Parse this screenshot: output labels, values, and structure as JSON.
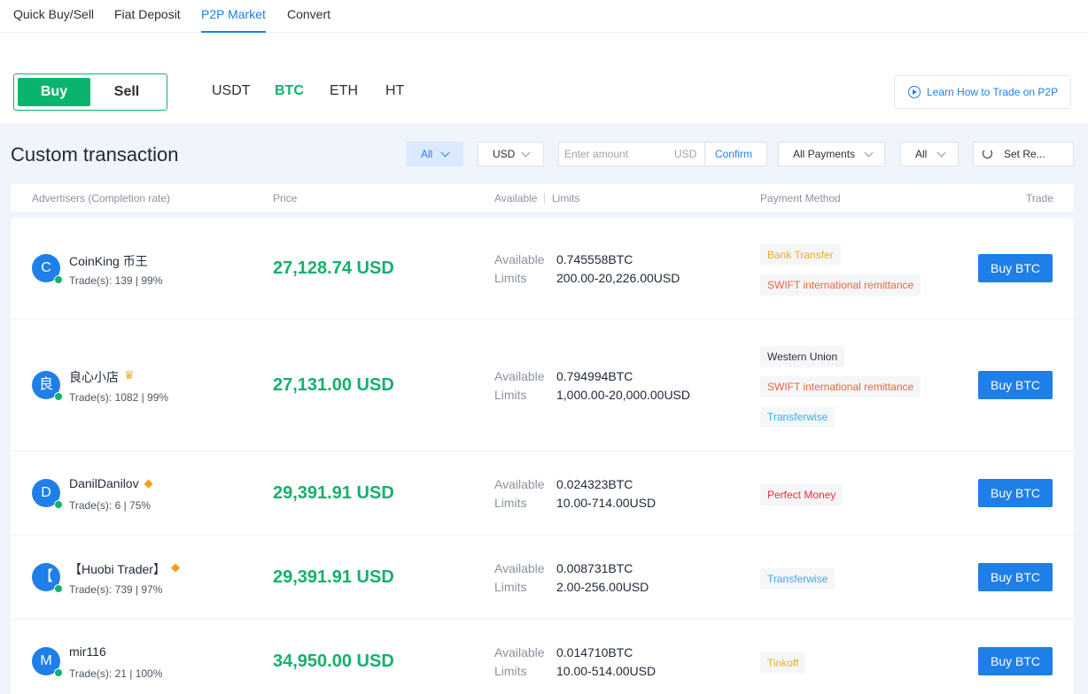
{
  "nav": {
    "tabs": [
      {
        "label": "Quick Buy/Sell"
      },
      {
        "label": "Fiat Deposit"
      },
      {
        "label": "P2P Market"
      },
      {
        "label": "Convert"
      }
    ]
  },
  "trade_side": {
    "buy": "Buy",
    "sell": "Sell"
  },
  "coins": [
    "USDT",
    "BTC",
    "ETH",
    "HT"
  ],
  "learn_link": "Learn How to Trade on P2P",
  "title": "Custom transaction",
  "filters": {
    "all": "All",
    "currency": "USD",
    "amount_placeholder": "Enter amount",
    "amount_unit": "USD",
    "confirm": "Confirm",
    "payments": "All Payments",
    "all2": "All",
    "set_refresh": "Set Re..."
  },
  "table_header": {
    "advertisers": "Advertisers (Completion rate)",
    "price": "Price",
    "available": "Available",
    "limits": "Limits",
    "payment": "Payment Method",
    "trade": "Trade"
  },
  "labels": {
    "available": "Available",
    "limits": "Limits",
    "buy_button": "Buy BTC"
  },
  "rows": [
    {
      "initial": "C",
      "name": "CoinKing 币王",
      "trades": "Trade(s): 139 | 99%",
      "price": "27,128.74 USD",
      "available": "0.745558BTC",
      "limits": "200.00-20,226.00USD",
      "payments": [
        "Bank Transfer",
        "SWIFT international remittance"
      ]
    },
    {
      "initial": "良",
      "name": "良心小店",
      "trades": "Trade(s): 1082 | 99%",
      "price": "27,131.00 USD",
      "available": "0.794994BTC",
      "limits": "1,000.00-20,000.00USD",
      "payments": [
        "Western Union",
        "SWIFT international remittance",
        "Transferwise"
      ]
    },
    {
      "initial": "D",
      "name": "DanilDanilov",
      "trades": "Trade(s): 6 | 75%",
      "price": "29,391.91 USD",
      "available": "0.024323BTC",
      "limits": "10.00-714.00USD",
      "payments": [
        "Perfect Money"
      ]
    },
    {
      "initial": "【",
      "name": "【Huobi Trader】",
      "trades": "Trade(s): 739 | 97%",
      "price": "29,391.91 USD",
      "available": "0.008731BTC",
      "limits": "2.00-256.00USD",
      "payments": [
        "Transferwise"
      ]
    },
    {
      "initial": "M",
      "name": "mir116",
      "trades": "Trade(s): 21 | 100%",
      "price": "34,950.00 USD",
      "available": "0.014710BTC",
      "limits": "10.00-514.00USD",
      "payments": [
        "Tinkoff"
      ]
    }
  ],
  "payment_colors": {
    "Bank Transfer": "#f2a922",
    "SWIFT international remittance": "#e8663d",
    "Western Union": "#2b2f36",
    "Transferwise": "#2cb4e5",
    "Perfect Money": "#e8303a",
    "Tinkoff": "#e8a93a"
  },
  "colors": {
    "accent": "#1f7fe8",
    "green": "#0bb46e",
    "panel": "#f0f4fb"
  }
}
